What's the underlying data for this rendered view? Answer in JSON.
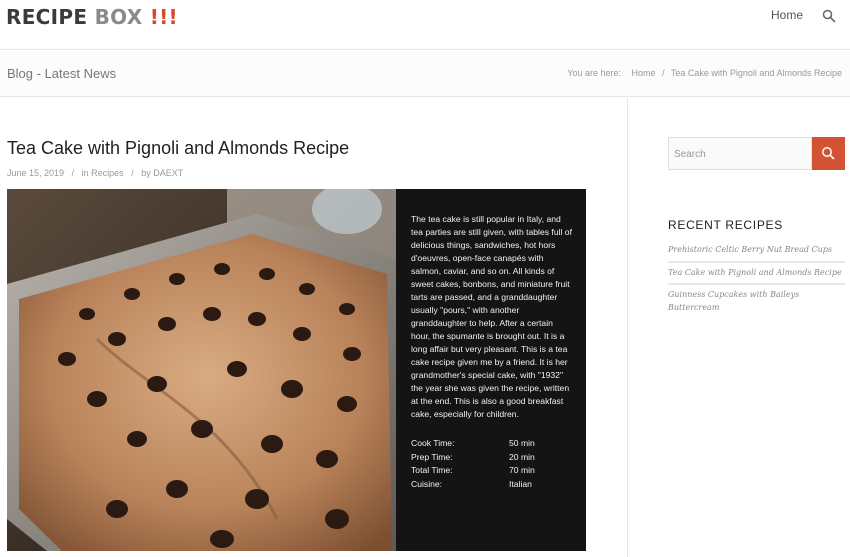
{
  "header": {
    "logo": {
      "part1": "RECIPE",
      "part2": "BOX",
      "part3": "!!!"
    },
    "nav": {
      "home": "Home"
    },
    "search_icon": "search-icon"
  },
  "subheader": {
    "title": "Blog - Latest News",
    "breadcrumb": {
      "prefix": "You are here:",
      "items": [
        "Home",
        "Tea Cake with Pignoli and Almonds Recipe"
      ]
    }
  },
  "post": {
    "title": "Tea Cake with Pignoli and Almonds Recipe",
    "date": "June 15, 2019",
    "category_prefix": "in",
    "category": "Recipes",
    "author_prefix": "by",
    "author": "DAEXT",
    "description": "The tea cake is still popular in Italy, and tea parties are still given, with tables full of delicious things, sandwiches, hot hors d'oeuvres, open-face canapés with salmon, caviar, and so on. All kinds of sweet cakes, bonbons, and miniature fruit tarts are passed, and a granddaughter usually \"pours,\" with another granddaughter to help. After a certain hour, the spumante is brought out. It is a long affair but very pleasant. This is a tea cake recipe given me by a friend. It is her grandmother's special cake, with \"1932\" the year she was given the recipe, written at the end. This is also a good breakfast cake, especially for children.",
    "details": [
      {
        "label": "Cook Time:",
        "value": "50 min"
      },
      {
        "label": "Prep Time:",
        "value": "20 min"
      },
      {
        "label": "Total Time:",
        "value": "70 min"
      },
      {
        "label": "Cuisine:",
        "value": "Italian"
      }
    ]
  },
  "sidebar": {
    "search_placeholder": "Search",
    "recent_title": "RECENT RECIPES",
    "recent": [
      "Prehistoric Celtic Berry Nut Bread Cups",
      "Tea Cake with Pignoli and Almonds Recipe",
      "Guinness Cupcakes with Baileys Buttercream"
    ]
  },
  "colors": {
    "accent": "#d45234",
    "logo_exclaim": "#d84a2b"
  }
}
